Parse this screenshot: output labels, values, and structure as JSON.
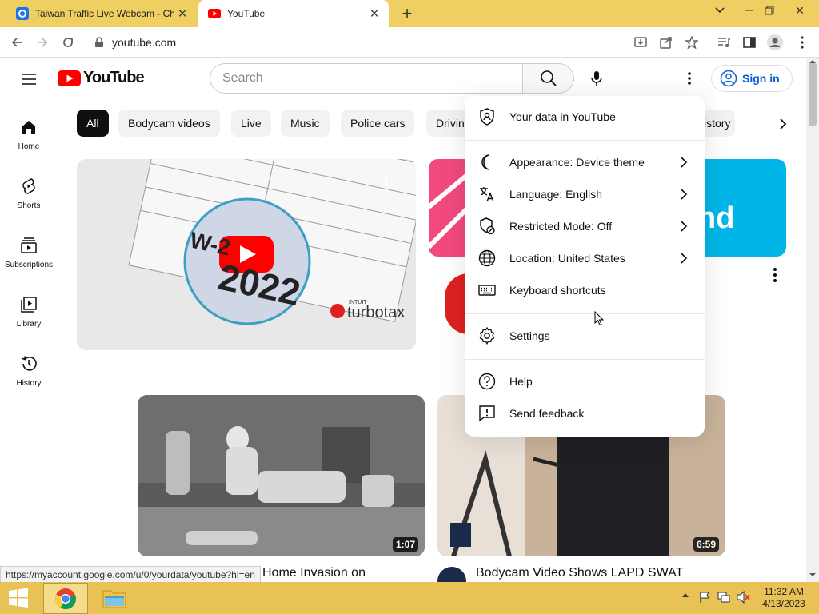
{
  "browser": {
    "tabs": [
      {
        "title": "Taiwan Traffic Live Webcam - Chi"
      },
      {
        "title": "YouTube"
      }
    ],
    "url": "youtube.com",
    "colors": {
      "titlebar": "#f0cf62",
      "taskbar": "#e8c255"
    }
  },
  "youtube": {
    "logo_text": "YouTube",
    "search_placeholder": "Search",
    "signin_label": "Sign in",
    "nav": [
      {
        "label": "Home",
        "icon": "home-icon"
      },
      {
        "label": "Shorts",
        "icon": "shorts-icon"
      },
      {
        "label": "Subscriptions",
        "icon": "subscriptions-icon"
      },
      {
        "label": "Library",
        "icon": "library-icon"
      },
      {
        "label": "History",
        "icon": "history-icon"
      }
    ],
    "chips": [
      "All",
      "Bodycam videos",
      "Live",
      "Music",
      "Police cars",
      "Drivin",
      "istory"
    ],
    "videos": [
      {
        "duration": "1:07",
        "title": "Home Invasion on"
      },
      {
        "duration": "6:59",
        "title": "Bodycam Video Shows LAPD SWAT"
      }
    ],
    "ad_thumb_text": "turbotax",
    "ad_thumb_brand": "INTUIT",
    "ad_thumb_w2": "W-2",
    "ad_thumb_year": "2022",
    "right_ad_text": "nd"
  },
  "menu": {
    "items": [
      {
        "label": "Your data in YouTube",
        "icon": "shield-person-icon",
        "submenu": false
      },
      {
        "label": "Appearance: Device theme",
        "icon": "moon-icon",
        "submenu": true
      },
      {
        "label": "Language: English",
        "icon": "translate-icon",
        "submenu": true
      },
      {
        "label": "Restricted Mode: Off",
        "icon": "restricted-icon",
        "submenu": true
      },
      {
        "label": "Location: United States",
        "icon": "globe-icon",
        "submenu": true
      },
      {
        "label": "Keyboard shortcuts",
        "icon": "keyboard-icon",
        "submenu": false
      },
      {
        "label": "Settings",
        "icon": "gear-icon",
        "submenu": false
      },
      {
        "label": "Help",
        "icon": "help-icon",
        "submenu": false
      },
      {
        "label": "Send feedback",
        "icon": "feedback-icon",
        "submenu": false
      }
    ]
  },
  "status_link": "https://myaccount.google.com/u/0/yourdata/youtube?hl=en",
  "clock": {
    "time": "11:32 AM",
    "date": "4/13/2023"
  }
}
